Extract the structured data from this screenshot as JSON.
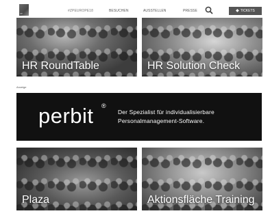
{
  "header": {
    "hashtag": "#ZPEUROPE18",
    "nav": [
      "BESUCHEN",
      "AUSSTELLEN",
      "PRESSE"
    ],
    "ticket_label": "TICKETS",
    "logo_text": "ZP"
  },
  "tiles_top": [
    {
      "caption": "HR RoundTable"
    },
    {
      "caption": "HR Solution Check"
    }
  ],
  "ad": {
    "label": "Anzeige",
    "brand": "perbit",
    "trademark": "®",
    "line1": "Der Spezialist für individualisierbare",
    "line2": "Personalmanagement-Software."
  },
  "tiles_bottom": [
    {
      "caption": "Plaza"
    },
    {
      "caption": "Aktionsfläche Training"
    }
  ]
}
